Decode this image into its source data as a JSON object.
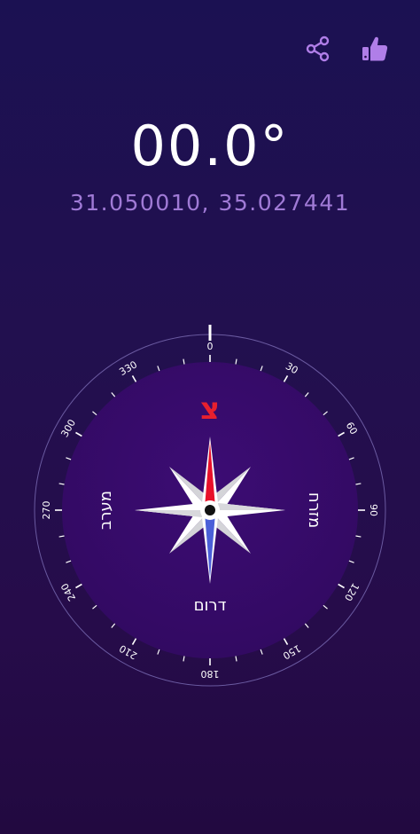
{
  "actions": {
    "share_icon": "share-icon",
    "like_icon": "thumbs-up-icon",
    "accent": "#b07ee8"
  },
  "reading": {
    "heading": "00.0°",
    "coordinates": "31.050010, 35.027441"
  },
  "compass": {
    "degree_labels": [
      "0",
      "30",
      "60",
      "90",
      "120",
      "150",
      "180",
      "210",
      "240",
      "270",
      "300",
      "330"
    ],
    "directions": {
      "north": "צ",
      "east": "מזרח",
      "south": "דרום",
      "west": "מערב"
    },
    "colors": {
      "dial": "#360a6c",
      "north_needle": "#e8102a",
      "south_needle": "#4a5fd8",
      "north_letter": "#e8202e"
    }
  }
}
